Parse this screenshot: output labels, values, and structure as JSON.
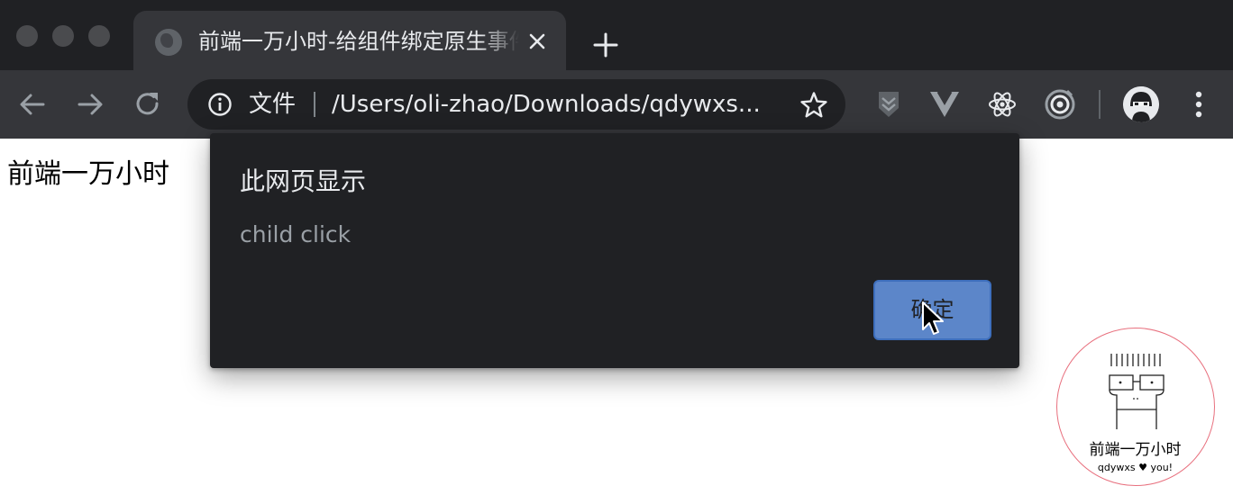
{
  "browser": {
    "tab": {
      "title": "前端一万小时-给组件绑定原生事件"
    },
    "omnibox": {
      "scheme_label": "文件",
      "url": "/Users/oli-zhao/Downloads/qdywxs..."
    }
  },
  "page": {
    "heading": "前端一万小时"
  },
  "dialog": {
    "title": "此网页显示",
    "message": "child click",
    "ok_label": "确定"
  },
  "watermark": {
    "title": "前端一万小时",
    "subtitle": "qdywxs ♥ you!"
  },
  "colors": {
    "tabstrip_bg": "#202124",
    "toolbar_bg": "#35363a",
    "dialog_bg": "#202124",
    "button_bg": "#5c86c9",
    "watermark_ring": "#e8707e"
  },
  "icons": [
    "globe-icon",
    "close-icon",
    "plus-icon",
    "back-arrow-icon",
    "forward-arrow-icon",
    "reload-icon",
    "info-icon",
    "star-icon",
    "shield-extension-icon",
    "vue-devtools-icon",
    "react-devtools-icon",
    "target-extension-icon",
    "avatar",
    "kebab-menu-icon",
    "mouse-cursor-icon"
  ]
}
